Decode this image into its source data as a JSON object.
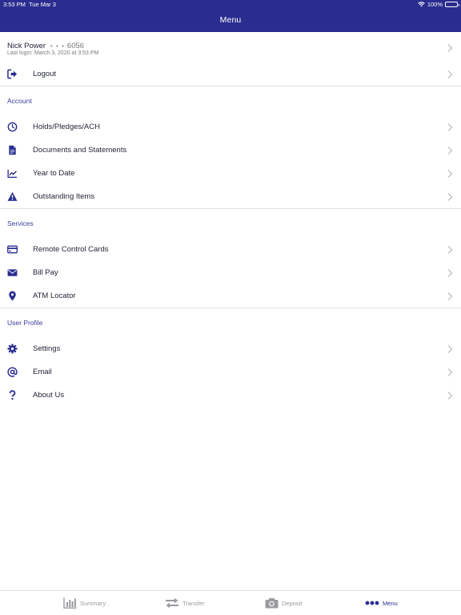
{
  "status_bar": {
    "time": "3:53 PM",
    "date": "Tue Mar 3",
    "battery": "100%"
  },
  "header": {
    "title": "Menu"
  },
  "profile": {
    "name": "Nick Power",
    "dots": "• • •",
    "account_suffix": "6056",
    "last_login": "Last login: March 3, 2020 at 3:53 PM"
  },
  "logout": {
    "label": "Logout"
  },
  "sections": {
    "account": {
      "title": "Account",
      "items": [
        "Holds/Pledges/ACH",
        "Documents and Statements",
        "Year to Date",
        "Outstanding Items"
      ]
    },
    "services": {
      "title": "Services",
      "items": [
        "Remote Control Cards",
        "Bill Pay",
        "ATM Locator"
      ]
    },
    "user_profile": {
      "title": "User Profile",
      "items": [
        "Settings",
        "Email",
        "About Us"
      ]
    }
  },
  "tabbar": {
    "tabs": [
      "Summary",
      "Transfer",
      "Deposit",
      "Menu"
    ],
    "active": "Menu"
  },
  "colors": {
    "brand": "#2a2d8f",
    "divider": "#e2e2e6",
    "chevron": "#b8b8bd"
  }
}
